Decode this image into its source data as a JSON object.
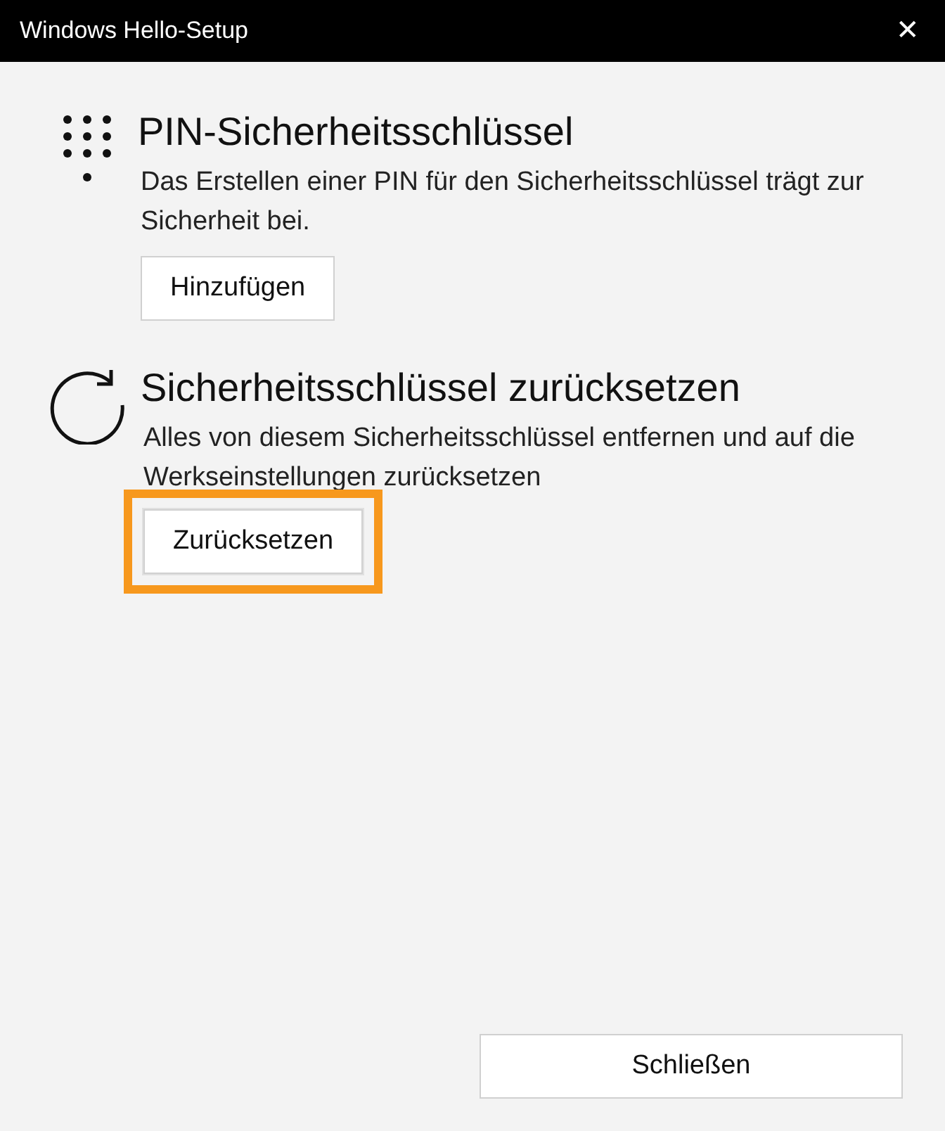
{
  "window": {
    "title": "Windows Hello-Setup",
    "close": "✕"
  },
  "sections": [
    {
      "kind": "keypad",
      "heading": "PIN-Sicherheitsschlüssel",
      "description": "Das Erstellen einer PIN für den Sicherheitsschlüssel trägt zur Sicherheit bei.",
      "button": {
        "label": "Hinzufügen",
        "highlighted": false
      }
    },
    {
      "kind": "reset",
      "heading": "Sicherheitsschlüssel zurücksetzen",
      "description": "Alles von diesem Sicherheitsschlüssel entfernen und auf die Werkseinstellungen zurücksetzen",
      "button": {
        "label": "Zurücksetzen",
        "highlighted": true
      }
    }
  ],
  "footer_button": "Schließen"
}
